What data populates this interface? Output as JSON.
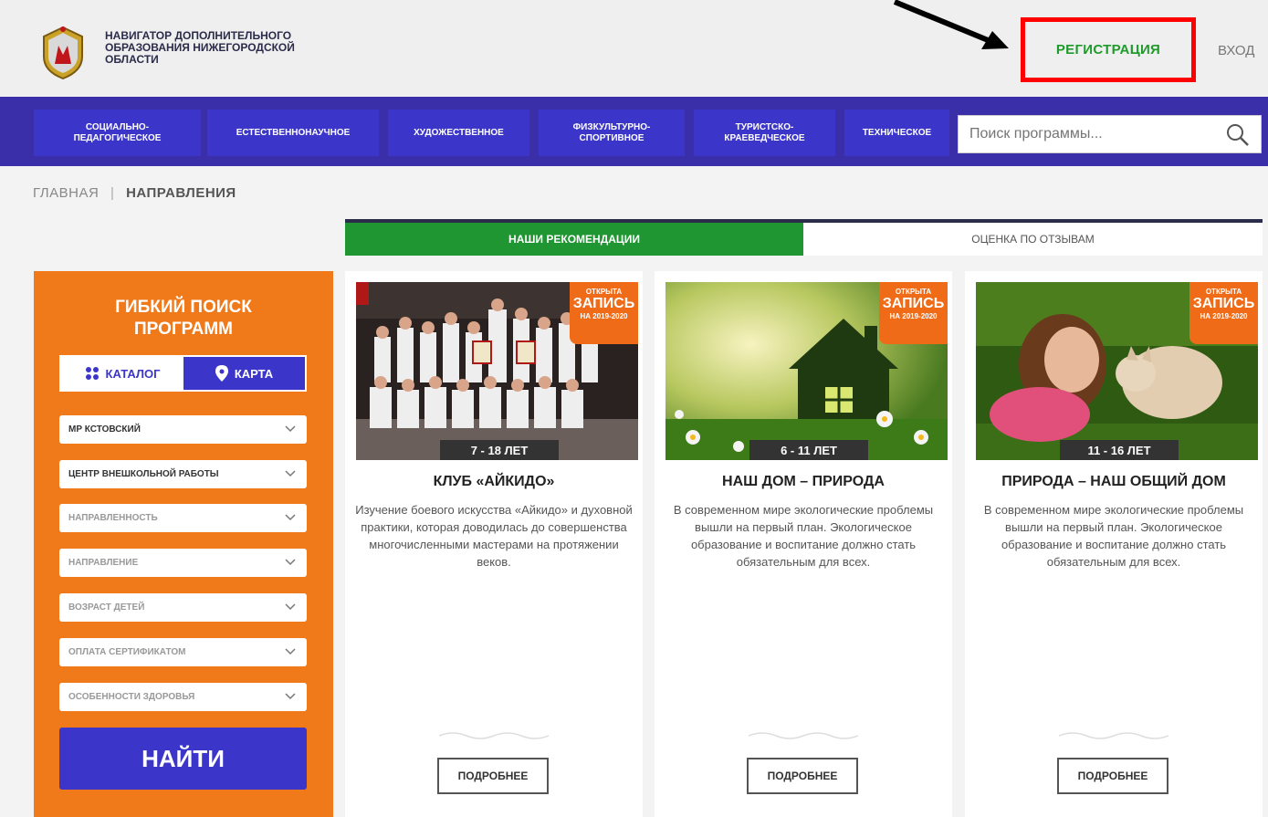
{
  "header": {
    "logo_text": "НАВИГАТОР ДОПОЛНИТЕЛЬНОГО ОБРАЗОВАНИЯ НИЖЕГОРОДСКОЙ ОБЛАСТИ",
    "register_label": "РЕГИСТРАЦИЯ",
    "login_label": "ВХОД"
  },
  "nav": {
    "items": [
      {
        "label": "СОЦИАЛЬНО-\nПЕДАГОГИЧЕСКОЕ"
      },
      {
        "label": "ЕСТЕСТВЕННОНАУЧНОЕ"
      },
      {
        "label": "ХУДОЖЕСТВЕННОЕ"
      },
      {
        "label": "ФИЗКУЛЬТУРНО-\nСПОРТИВНОЕ"
      },
      {
        "label": "ТУРИСТСКО-\nКРАЕВЕДЧЕСКОЕ"
      },
      {
        "label": "ТЕХНИЧЕСКОЕ"
      }
    ],
    "search_placeholder": "Поиск программы..."
  },
  "breadcrumb": {
    "home": "ГЛАВНАЯ",
    "separator": "|",
    "current": "НАПРАВЛЕНИЯ"
  },
  "tabs": {
    "active": "НАШИ РЕКОМЕНДАЦИИ",
    "inactive": "ОЦЕНКА ПО ОТЗЫВАМ"
  },
  "sidebar": {
    "title_line1": "ГИБКИЙ ПОИСК",
    "title_line2": "ПРОГРАММ",
    "catalog_label": "КАТАЛОГ",
    "map_label": "КАРТА",
    "selects": [
      {
        "value": "МР КСТОВСКИЙ",
        "selected": true
      },
      {
        "value": "ЦЕНТР ВНЕШКОЛЬНОЙ РАБОТЫ",
        "selected": true
      },
      {
        "value": "НАПРАВЛЕННОСТЬ",
        "selected": false
      },
      {
        "value": "НАПРАВЛЕНИЕ",
        "selected": false
      },
      {
        "value": "ВОЗРАСТ ДЕТЕЙ",
        "selected": false
      },
      {
        "value": "ОПЛАТА СЕРТИФИКАТОМ",
        "selected": false
      },
      {
        "value": "ОСОБЕННОСТИ ЗДОРОВЬЯ",
        "selected": false
      }
    ],
    "find_label": "НАЙТИ"
  },
  "badge": {
    "line1": "ОТКРЫТА",
    "line2": "ЗАПИСЬ",
    "line3": "НА 2019-2020"
  },
  "cards": [
    {
      "age": "7 - 18 ЛЕТ",
      "title": "КЛУБ «АЙКИДО»",
      "description": "Изучение боевого искусства «Айкидо» и духовной практики, которая доводилась до совершенства многочисленными мастерами на протяжении веков.",
      "more_label": "ПОДРОБНЕЕ"
    },
    {
      "age": "6 - 11 ЛЕТ",
      "title": "НАШ ДОМ – ПРИРОДА",
      "description": "В современном мире экологические проблемы вышли на первый план. Экологическое образование и воспитание должно стать обязательным для всех.",
      "more_label": "ПОДРОБНЕЕ"
    },
    {
      "age": "11 - 16 ЛЕТ",
      "title": "ПРИРОДА – НАШ ОБЩИЙ ДОМ",
      "description": "В современном мире экологические проблемы вышли на первый план. Экологическое образование и воспитание должно стать обязательным для всех.",
      "more_label": "ПОДРОБНЕЕ"
    }
  ],
  "colors": {
    "nav_bg": "#3a2fa8",
    "accent_green": "#1f9632",
    "sidebar_orange": "#f07a1a",
    "highlight_red": "#ff0000"
  }
}
